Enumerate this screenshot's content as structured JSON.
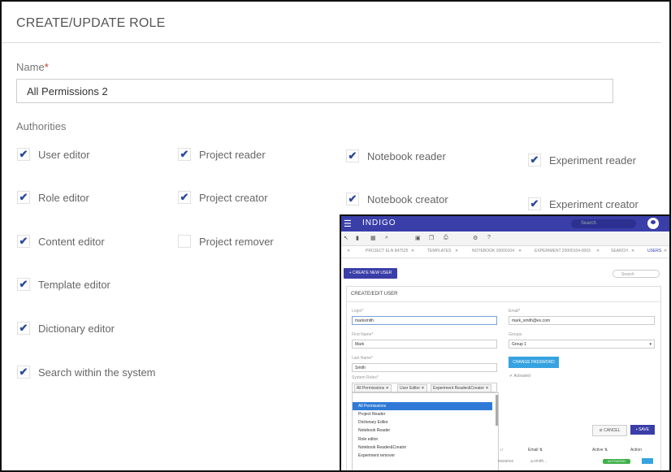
{
  "role": {
    "title": "CREATE/UPDATE ROLE",
    "name_label": "Name",
    "name_required_mark": "*",
    "name_value": "All Permissions 2",
    "authorities_label": "Authorities",
    "permissions": [
      {
        "label": "User editor",
        "checked": true
      },
      {
        "label": "Project reader",
        "checked": true
      },
      {
        "label": "Notebook reader",
        "checked": true
      },
      {
        "label": "Experiment reader",
        "checked": true
      },
      {
        "label": "Role editor",
        "checked": true
      },
      {
        "label": "Project creator",
        "checked": true
      },
      {
        "label": "Notebook creator",
        "checked": true
      },
      {
        "label": "Experiment creator",
        "checked": true
      },
      {
        "label": "Content editor",
        "checked": true
      },
      {
        "label": "Project remover",
        "checked": false
      },
      {
        "label": "Template editor",
        "checked": true
      },
      {
        "label": "Dictionary editor",
        "checked": true
      },
      {
        "label": "Search within the system",
        "checked": true
      }
    ]
  },
  "inset": {
    "appbar": {
      "menu_icon": "hamburger-icon",
      "logo": "INDIGO",
      "search_placeholder": "Search",
      "user_icon": "user-avatar-icon",
      "color": "#3a3ea8"
    },
    "toolbar_icons": [
      "pointer-icon",
      "new-file-icon",
      "grid-icon",
      "search-icon",
      "save-icon",
      "copy-icon",
      "print-icon",
      "settings-icon",
      "help-icon"
    ],
    "tabs": [
      "PROJECT ELN 847525",
      "TEMPLATES",
      "NOTEBOOK 20000104",
      "EXPERIMENT 20000104-0003",
      "SEARCH",
      "USERS"
    ],
    "create_user_button": "+ CREATE NEW USER",
    "search_placeholder": "Search",
    "panel_title": "CREATE/EDIT USER",
    "fields": {
      "login_label": "Login*",
      "login_value": "marksmith",
      "email_label": "Email*",
      "email_value": "mark_smith@ex.com",
      "first_name_label": "First Name*",
      "first_name_value": "Mark",
      "groups_label": "Groups",
      "groups_value": "Group 1",
      "last_name_label": "Last Name*",
      "last_name_value": "Smith",
      "system_roles_label": "System Roles*"
    },
    "change_password_button": "CHANGE PASSWORD",
    "activated_label": "Activated",
    "role_chips": [
      "All Permissions",
      "User Editor",
      "Experiment Reader&Creator"
    ],
    "dropdown_items": [
      "All Permissions",
      "Project Reader",
      "Dictionary Editor",
      "Notebook Reader",
      "Role editor",
      "Notebook Reader&Creator",
      "Experiment remover"
    ],
    "cancel_button": "CANCEL",
    "save_button": "SAVE",
    "table_headers": [
      "Email ⇅",
      "Active ⇅",
      "Action"
    ],
    "row_fragment": "learance",
    "row_email": "a.smith...",
    "row_badge": "ACTIVATED"
  }
}
